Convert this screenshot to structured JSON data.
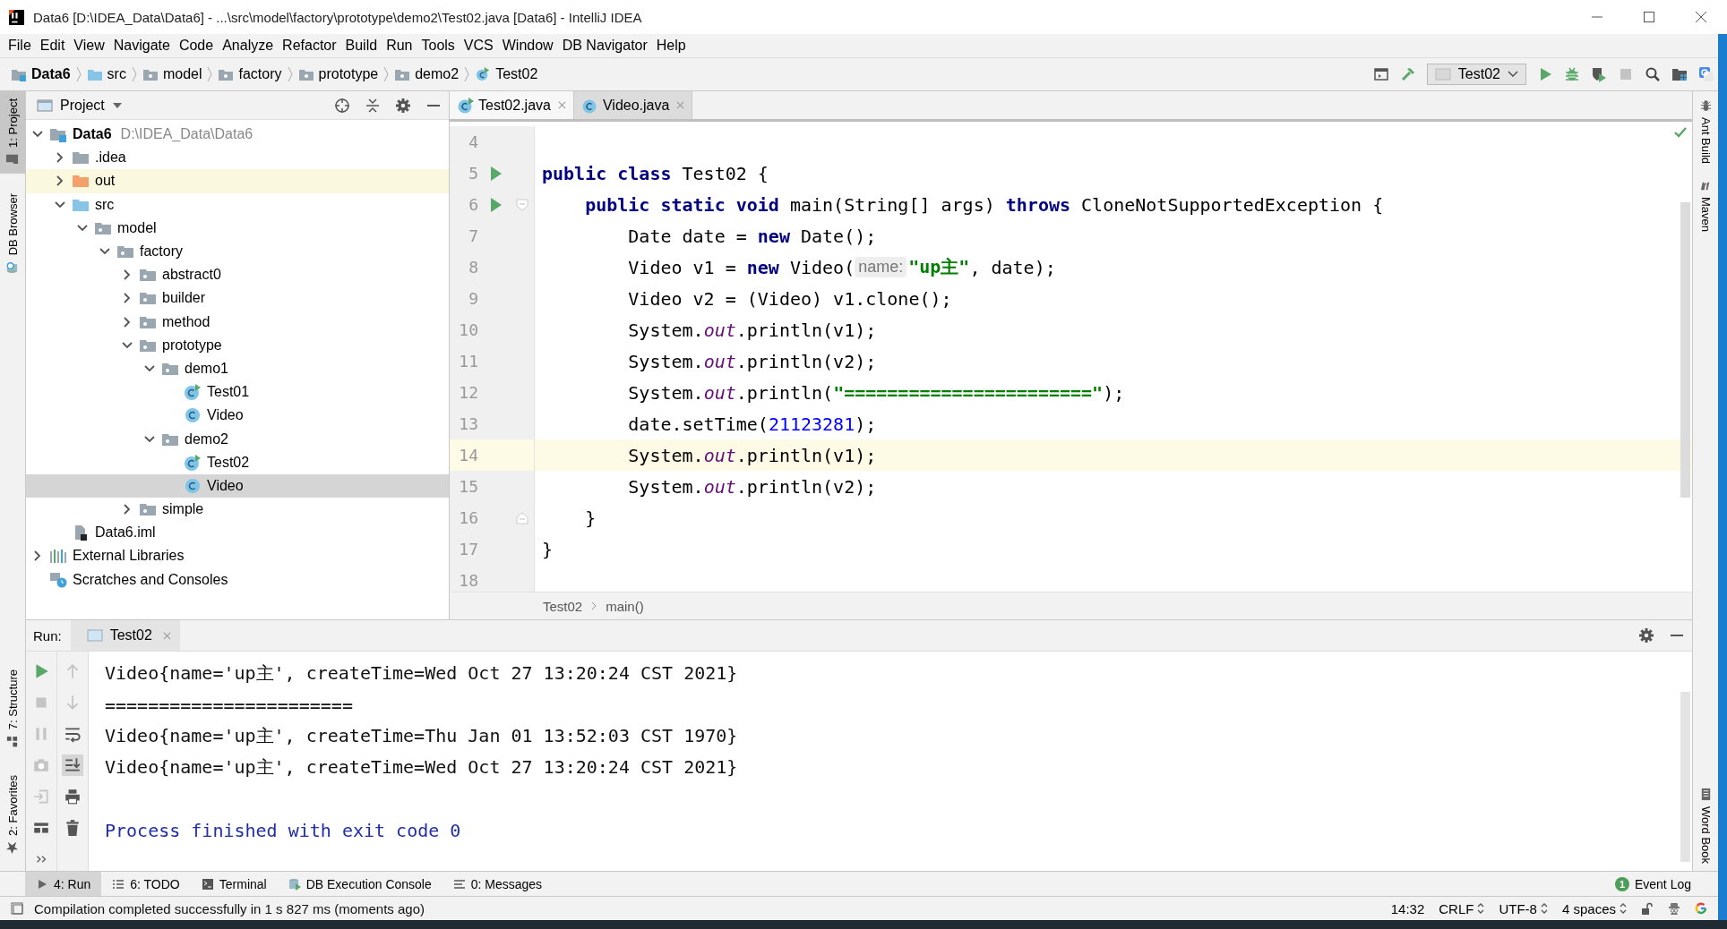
{
  "window": {
    "title": "Data6 [D:\\IDEA_Data\\Data6] - ...\\src\\model\\factory\\prototype\\demo2\\Test02.java [Data6] - IntelliJ IDEA"
  },
  "menu": [
    "File",
    "Edit",
    "View",
    "Navigate",
    "Code",
    "Analyze",
    "Refactor",
    "Build",
    "Run",
    "Tools",
    "VCS",
    "Window",
    "DB Navigator",
    "Help"
  ],
  "breadcrumbs": [
    {
      "label": "Data6",
      "kind": "module"
    },
    {
      "label": "src",
      "kind": "source"
    },
    {
      "label": "model",
      "kind": "package"
    },
    {
      "label": "factory",
      "kind": "package"
    },
    {
      "label": "prototype",
      "kind": "package"
    },
    {
      "label": "demo2",
      "kind": "package"
    },
    {
      "label": "Test02",
      "kind": "runnable"
    }
  ],
  "run_config": {
    "label": "Test02"
  },
  "left_tool_windows": [
    {
      "label": "1: Project",
      "selected": true,
      "kind": "project"
    },
    {
      "label": "DB Browser",
      "selected": false,
      "kind": "db"
    }
  ],
  "left_bottom_tool_windows": [
    {
      "label": "7: Structure",
      "kind": "structure"
    },
    {
      "label": "2: Favorites",
      "kind": "favorites"
    }
  ],
  "right_tool_windows": [
    {
      "label": "Ant Build",
      "kind": "ant"
    },
    {
      "label": "Maven",
      "kind": "maven"
    },
    {
      "label": "Word Book",
      "kind": "book"
    }
  ],
  "project": {
    "title": "Project",
    "tree": [
      {
        "label": "Data6",
        "path": "D:\\IDEA_Data\\Data6",
        "kind": "module",
        "expanded": true,
        "selected": false,
        "children": [
          {
            "label": ".idea",
            "kind": "folder",
            "expanded": false,
            "selected": false
          },
          {
            "label": "out",
            "kind": "excluded",
            "expanded": false,
            "selected": false
          },
          {
            "label": "src",
            "kind": "source",
            "expanded": true,
            "selected": false,
            "children": [
              {
                "label": "model",
                "kind": "package",
                "expanded": true,
                "selected": false,
                "children": [
                  {
                    "label": "factory",
                    "kind": "package",
                    "expanded": true,
                    "selected": false,
                    "children": [
                      {
                        "label": "abstract0",
                        "kind": "package",
                        "expanded": false,
                        "selected": false
                      },
                      {
                        "label": "builder",
                        "kind": "package",
                        "expanded": false,
                        "selected": false
                      },
                      {
                        "label": "method",
                        "kind": "package",
                        "expanded": false,
                        "selected": false
                      },
                      {
                        "label": "prototype",
                        "kind": "package",
                        "expanded": true,
                        "selected": false,
                        "children": [
                          {
                            "label": "demo1",
                            "kind": "package",
                            "expanded": true,
                            "selected": false,
                            "children": [
                              {
                                "label": "Test01",
                                "kind": "runnable",
                                "selected": false
                              },
                              {
                                "label": "Video",
                                "kind": "class",
                                "selected": false
                              }
                            ]
                          },
                          {
                            "label": "demo2",
                            "kind": "package",
                            "expanded": true,
                            "selected": false,
                            "children": [
                              {
                                "label": "Test02",
                                "kind": "runnable",
                                "selected": false
                              },
                              {
                                "label": "Video",
                                "kind": "class",
                                "selected": true
                              }
                            ]
                          }
                        ]
                      },
                      {
                        "label": "simple",
                        "kind": "package",
                        "expanded": false,
                        "selected": false
                      }
                    ]
                  }
                ]
              }
            ]
          },
          {
            "label": "Data6.iml",
            "kind": "iml",
            "selected": false
          }
        ]
      },
      {
        "label": "External Libraries",
        "kind": "libraries",
        "expanded": false,
        "selected": false
      },
      {
        "label": "Scratches and Consoles",
        "kind": "scratches",
        "selected": false
      }
    ]
  },
  "editor": {
    "tabs": [
      {
        "label": "Test02.java",
        "kind": "runnable",
        "selected": true
      },
      {
        "label": "Video.java",
        "kind": "class",
        "selected": false
      }
    ],
    "lines": [
      {
        "number": "4",
        "kind": "plain",
        "current": false
      },
      {
        "number": "5",
        "kind": "run",
        "current": false,
        "tokens": [
          {
            "kind": "keyword",
            "text": "public class"
          },
          {
            "kind": "plain",
            "text": " Test02 {"
          }
        ]
      },
      {
        "number": "6",
        "kind": "run-fold",
        "current": false,
        "tokens": [
          {
            "kind": "keyword",
            "text": "    public static void"
          },
          {
            "kind": "plain",
            "text": " main(String[] args) "
          },
          {
            "kind": "keyword",
            "text": "throws"
          },
          {
            "kind": "plain",
            "text": " CloneNotSupportedException {"
          }
        ]
      },
      {
        "number": "7",
        "kind": "plain",
        "current": false,
        "tokens": [
          {
            "kind": "plain",
            "text": "        Date date = "
          },
          {
            "kind": "keyword",
            "text": "new"
          },
          {
            "kind": "plain",
            "text": " Date();"
          }
        ]
      },
      {
        "number": "8",
        "kind": "plain",
        "current": false,
        "tokens": [
          {
            "kind": "plain",
            "text": "        Video v1 = "
          },
          {
            "kind": "keyword",
            "text": "new"
          },
          {
            "kind": "plain",
            "text": " Video("
          },
          {
            "kind": "hint",
            "text": "name:"
          },
          {
            "kind": "string",
            "text": "\"up主\""
          },
          {
            "kind": "plain",
            "text": ", date);"
          }
        ]
      },
      {
        "number": "9",
        "kind": "plain",
        "current": false,
        "tokens": [
          {
            "kind": "plain",
            "text": "        Video v2 = (Video) v1.clone();"
          }
        ]
      },
      {
        "number": "10",
        "kind": "plain",
        "current": false,
        "tokens": [
          {
            "kind": "plain",
            "text": "        System."
          },
          {
            "kind": "field",
            "text": "out"
          },
          {
            "kind": "plain",
            "text": ".println(v1);"
          }
        ]
      },
      {
        "number": "11",
        "kind": "plain",
        "current": false,
        "tokens": [
          {
            "kind": "plain",
            "text": "        System."
          },
          {
            "kind": "field",
            "text": "out"
          },
          {
            "kind": "plain",
            "text": ".println(v2);"
          }
        ]
      },
      {
        "number": "12",
        "kind": "plain",
        "current": false,
        "tokens": [
          {
            "kind": "plain",
            "text": "        System."
          },
          {
            "kind": "field",
            "text": "out"
          },
          {
            "kind": "plain",
            "text": ".println("
          },
          {
            "kind": "string",
            "text": "\"=======================\""
          },
          {
            "kind": "plain",
            "text": ");"
          }
        ]
      },
      {
        "number": "13",
        "kind": "plain",
        "current": false,
        "tokens": [
          {
            "kind": "plain",
            "text": "        date.setTime("
          },
          {
            "kind": "number",
            "text": "21123281"
          },
          {
            "kind": "plain",
            "text": ");"
          }
        ]
      },
      {
        "number": "14",
        "kind": "plain",
        "current": true,
        "tokens": [
          {
            "kind": "plain",
            "text": "        System."
          },
          {
            "kind": "field",
            "text": "out"
          },
          {
            "kind": "plain",
            "text": ".println(v1);"
          }
        ]
      },
      {
        "number": "15",
        "kind": "plain",
        "current": false,
        "tokens": [
          {
            "kind": "plain",
            "text": "        System."
          },
          {
            "kind": "field",
            "text": "out"
          },
          {
            "kind": "plain",
            "text": ".println(v2);"
          }
        ]
      },
      {
        "number": "16",
        "kind": "fold-end",
        "current": false,
        "tokens": [
          {
            "kind": "plain",
            "text": "    }"
          }
        ]
      },
      {
        "number": "17",
        "kind": "plain",
        "current": false,
        "tokens": [
          {
            "kind": "plain",
            "text": "}"
          }
        ]
      },
      {
        "number": "18",
        "kind": "plain",
        "current": false
      }
    ],
    "breadcrumbs": [
      "Test02",
      "main()"
    ]
  },
  "run": {
    "label": "Run:",
    "tabs": [
      {
        "label": "Test02",
        "selected": true
      }
    ],
    "output": [
      {
        "kind": "stdout",
        "text": "Video{name='up主', createTime=Wed Oct 27 13:20:24 CST 2021}"
      },
      {
        "kind": "stdout",
        "text": "======================="
      },
      {
        "kind": "stdout",
        "text": "Video{name='up主', createTime=Thu Jan 01 13:52:03 CST 1970}"
      },
      {
        "kind": "stdout",
        "text": "Video{name='up主', createTime=Wed Oct 27 13:20:24 CST 2021}"
      },
      {
        "kind": "system",
        "text": "Process finished with exit code 0"
      }
    ]
  },
  "tool_bar": [
    {
      "label": "4: Run",
      "kind": "run",
      "selected": true
    },
    {
      "label": "6: TODO",
      "kind": "todo",
      "selected": false
    },
    {
      "label": "Terminal",
      "kind": "terminal",
      "selected": false
    },
    {
      "label": "DB Execution Console",
      "kind": "db",
      "selected": false
    },
    {
      "label": "0: Messages",
      "kind": "messages",
      "selected": false
    }
  ],
  "event_log": {
    "label": "Event Log",
    "count": "1"
  },
  "status_bar": {
    "message": "Compilation completed successfully in 1 s 827 ms (moments ago)",
    "position": "14:32",
    "widgets": [
      "CRLF",
      "UTF-8",
      "4 spaces"
    ]
  }
}
